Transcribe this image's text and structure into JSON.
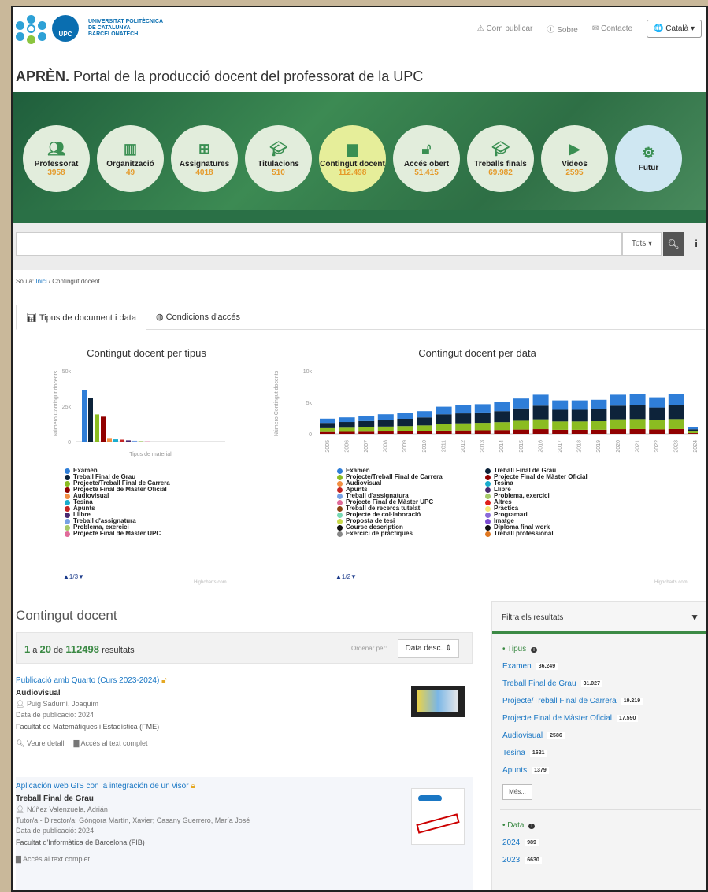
{
  "header": {
    "university": [
      "UNIVERSITAT POLITÈCNICA",
      "DE CATALUNYA",
      "BARCELONATECH"
    ],
    "upc_label": "UPC",
    "nav": {
      "publicar": "Com publicar",
      "sobre": "Sobre",
      "contacte": "Contacte",
      "lang": "Català"
    },
    "title_strong": "APRÈN.",
    "title_rest": "Portal de la producció docent del professorat de la UPC"
  },
  "circles": [
    {
      "label": "Professorat",
      "value": "3958",
      "icon": "users-icon"
    },
    {
      "label": "Organització",
      "value": "49",
      "icon": "building-icon"
    },
    {
      "label": "Assignatures",
      "value": "4018",
      "icon": "sitemap-icon"
    },
    {
      "label": "Titulacions",
      "value": "510",
      "icon": "graduate-icon"
    },
    {
      "label": "Contingut docent",
      "value": "112.498",
      "icon": "document-icon"
    },
    {
      "label": "Accés obert",
      "value": "51.415",
      "icon": "unlock-icon"
    },
    {
      "label": "Treballs finals",
      "value": "69.982",
      "icon": "cap-icon"
    },
    {
      "label": "Videos",
      "value": "2595",
      "icon": "video-icon"
    },
    {
      "label": "Futur",
      "value": "",
      "icon": "gear-icon"
    }
  ],
  "search": {
    "scope": "Tots"
  },
  "breadcrumb": {
    "prefix": "Sou a:",
    "home": "Inici",
    "current": "Contingut docent"
  },
  "tabs": [
    "Tipus de document i data",
    "Condicions d'accés"
  ],
  "chart_data": [
    {
      "type": "bar",
      "title": "Contingut docent per tipus",
      "xlabel": "Tipus de material",
      "ylabel": "Número Contingut docents",
      "ylim": [
        0,
        50000
      ],
      "yticks": [
        "50k",
        "25k",
        "0"
      ],
      "series": [
        {
          "name": "Examen",
          "color": "#2f7ed8",
          "values": [
            36249
          ]
        },
        {
          "name": "Treball Final de Grau",
          "color": "#0d233a",
          "values": [
            31027
          ]
        },
        {
          "name": "Projecte/Treball Final de Carrera",
          "color": "#8bbc21",
          "values": [
            19219
          ]
        },
        {
          "name": "Projecte Final de Màster Oficial",
          "color": "#910000",
          "values": [
            17590
          ]
        },
        {
          "name": "Audiovisual",
          "color": "#f28f43",
          "values": [
            2586
          ]
        },
        {
          "name": "Tesina",
          "color": "#1aadce",
          "values": [
            1621
          ]
        },
        {
          "name": "Apunts",
          "color": "#c42525",
          "values": [
            1379
          ]
        },
        {
          "name": "Llibre",
          "color": "#492970",
          "values": [
            900
          ]
        },
        {
          "name": "Treball d'assignatura",
          "color": "#77a1e5",
          "values": [
            600
          ]
        },
        {
          "name": "Problema, exercici",
          "color": "#a6c96a",
          "values": [
            400
          ]
        },
        {
          "name": "Projecte Final de Màster UPC",
          "color": "#e06b9a",
          "values": [
            200
          ]
        }
      ],
      "pager": "1/3"
    },
    {
      "type": "bar",
      "title": "Contingut docent per data",
      "ylabel": "Número Contingut docents",
      "ylim": [
        0,
        10000
      ],
      "yticks": [
        "10k",
        "5k",
        "0"
      ],
      "categories": [
        "2005",
        "2006",
        "2007",
        "2008",
        "2009",
        "2010",
        "2011",
        "2012",
        "2013",
        "2014",
        "2015",
        "2016",
        "2017",
        "2018",
        "2019",
        "2020",
        "2021",
        "2022",
        "2023",
        "2024"
      ],
      "totals": [
        2400,
        2600,
        2800,
        3100,
        3300,
        3600,
        4300,
        4500,
        4700,
        5000,
        5600,
        6200,
        5300,
        5300,
        5400,
        6200,
        6300,
        5800,
        6300,
        1000
      ],
      "pager": "1/2",
      "legend_left": [
        "Examen",
        "Projecte/Treball Final de Carrera",
        "Audiovisual",
        "Apunts",
        "Treball d'assignatura",
        "Projecte Final de Màster UPC",
        "Treball de recerca tutelat",
        "Projecte de col·laboració",
        "Proposta de tesi",
        "Course description",
        "Exercici de pràctiques"
      ],
      "legend_left_colors": [
        "#2f7ed8",
        "#8bbc21",
        "#f28f43",
        "#c42525",
        "#77a1e5",
        "#e06b9a",
        "#8b4513",
        "#77d9b5",
        "#c8d84a",
        "#111111",
        "#888888"
      ],
      "legend_right": [
        "Treball Final de Grau",
        "Projecte Final de Màster Oficial",
        "Tesina",
        "Llibre",
        "Problema, exercici",
        "Altres",
        "Pràctica",
        "Programari",
        "Imatge",
        "Diploma final work",
        "Treball professional"
      ],
      "legend_right_colors": [
        "#0d233a",
        "#910000",
        "#1aadce",
        "#492970",
        "#a6c96a",
        "#e0201a",
        "#f5e97a",
        "#8a6ad8",
        "#7b4bd0",
        "#111111",
        "#e07820"
      ]
    }
  ],
  "credit": "Highcharts.com",
  "results": {
    "section_title": "Contingut docent",
    "from": "1",
    "to": "20",
    "of_word": "de",
    "a_word": "a",
    "total": "112498",
    "suffix": "resultats",
    "order_label": "Ordenar per:",
    "order_value": "Data desc.",
    "items": [
      {
        "title": "Publicació amb Quarto (Curs 2023-2024)",
        "type": "Audiovisual",
        "author": "Puig Sadurní, Joaquim",
        "date": "Data de publicació: 2024",
        "faculty": "Facultat de Matemàtiques i Estadística (FME)",
        "detail": "Veure detall",
        "fulltext": "Accés al text complet"
      },
      {
        "title": "Aplicación web GIS con la integración de un visor",
        "type": "Treball Final de Grau",
        "author": "Núñez Valenzuela, Adrián",
        "tutor": "Tutor/a - Director/a: Góngora Martín, Xavier; Casany Guerrero, María José",
        "date": "Data de publicació: 2024",
        "faculty": "Facultat d'Informàtica de Barcelona (FIB)",
        "fulltext": "Accés al text complet"
      }
    ]
  },
  "filters": {
    "header": "Filtra els resultats",
    "tipus_label": "Tipus",
    "tipus": [
      {
        "label": "Examen",
        "count": "36.249"
      },
      {
        "label": "Treball Final de Grau",
        "count": "31.027"
      },
      {
        "label": "Projecte/Treball Final de Carrera",
        "count": "19.219"
      },
      {
        "label": "Projecte Final de Màster Oficial",
        "count": "17.590"
      },
      {
        "label": "Audiovisual",
        "count": "2586"
      },
      {
        "label": "Tesina",
        "count": "1621"
      },
      {
        "label": "Apunts",
        "count": "1379"
      }
    ],
    "mes": "Més...",
    "data_label": "Data",
    "data": [
      {
        "label": "2024",
        "count": "989"
      },
      {
        "label": "2023",
        "count": "6630"
      }
    ]
  }
}
